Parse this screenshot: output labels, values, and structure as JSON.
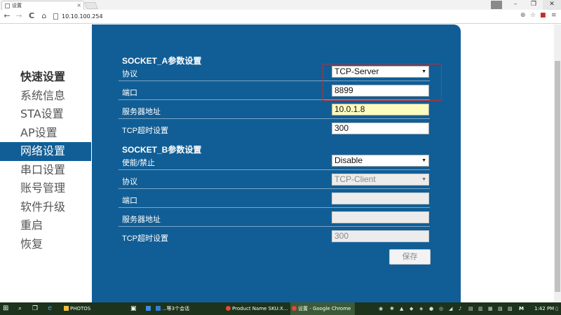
{
  "browser": {
    "tab_title": "设置",
    "address": "10.10.100.254",
    "tab_close": "×",
    "win_min": "–",
    "win_max": "❐",
    "win_close": "✕",
    "nav_back": "←",
    "nav_forward": "→",
    "nav_reload": "C",
    "nav_home": "⌂",
    "zoom_icon": "⊕",
    "star_icon": "☆",
    "menu_icon": "≡"
  },
  "sidebar": {
    "items": [
      {
        "label": "快速设置",
        "kind": "title"
      },
      {
        "label": "系统信息"
      },
      {
        "label": "STA设置"
      },
      {
        "label": "AP设置"
      },
      {
        "label": "网络设置",
        "active": true
      },
      {
        "label": "串口设置"
      },
      {
        "label": "账号管理"
      },
      {
        "label": "软件升级"
      },
      {
        "label": "重启"
      },
      {
        "label": "恢复"
      }
    ]
  },
  "socket_a": {
    "title": "SOCKET_A参数设置",
    "protocol_label": "协议",
    "protocol_value": "TCP-Server",
    "port_label": "端口",
    "port_value": "8899",
    "server_label": "服务器地址",
    "server_value": "10.0.1.8",
    "timeout_label": "TCP超时设置",
    "timeout_value": "300"
  },
  "socket_b": {
    "title": "SOCKET_B参数设置",
    "enable_label": "使能/禁止",
    "enable_value": "Disable",
    "protocol_label": "协议",
    "protocol_value": "TCP-Client",
    "port_label": "端口",
    "port_value": "",
    "server_label": "服务器地址",
    "server_value": "",
    "timeout_label": "TCP超时设置",
    "timeout_value": "300"
  },
  "save_label": "保存",
  "taskbar": {
    "items": [
      {
        "label": "PHOTOS"
      },
      {
        "label": "...等3个会话"
      },
      {
        "label": "Product Name SKU:X..."
      },
      {
        "label": "设置 - Google Chrome",
        "active": true
      }
    ],
    "clock": "1:42 PM"
  },
  "colors": {
    "panel": "#115e96",
    "accent_border": "#c62a30",
    "highlight_field": "#fcfcbf"
  }
}
